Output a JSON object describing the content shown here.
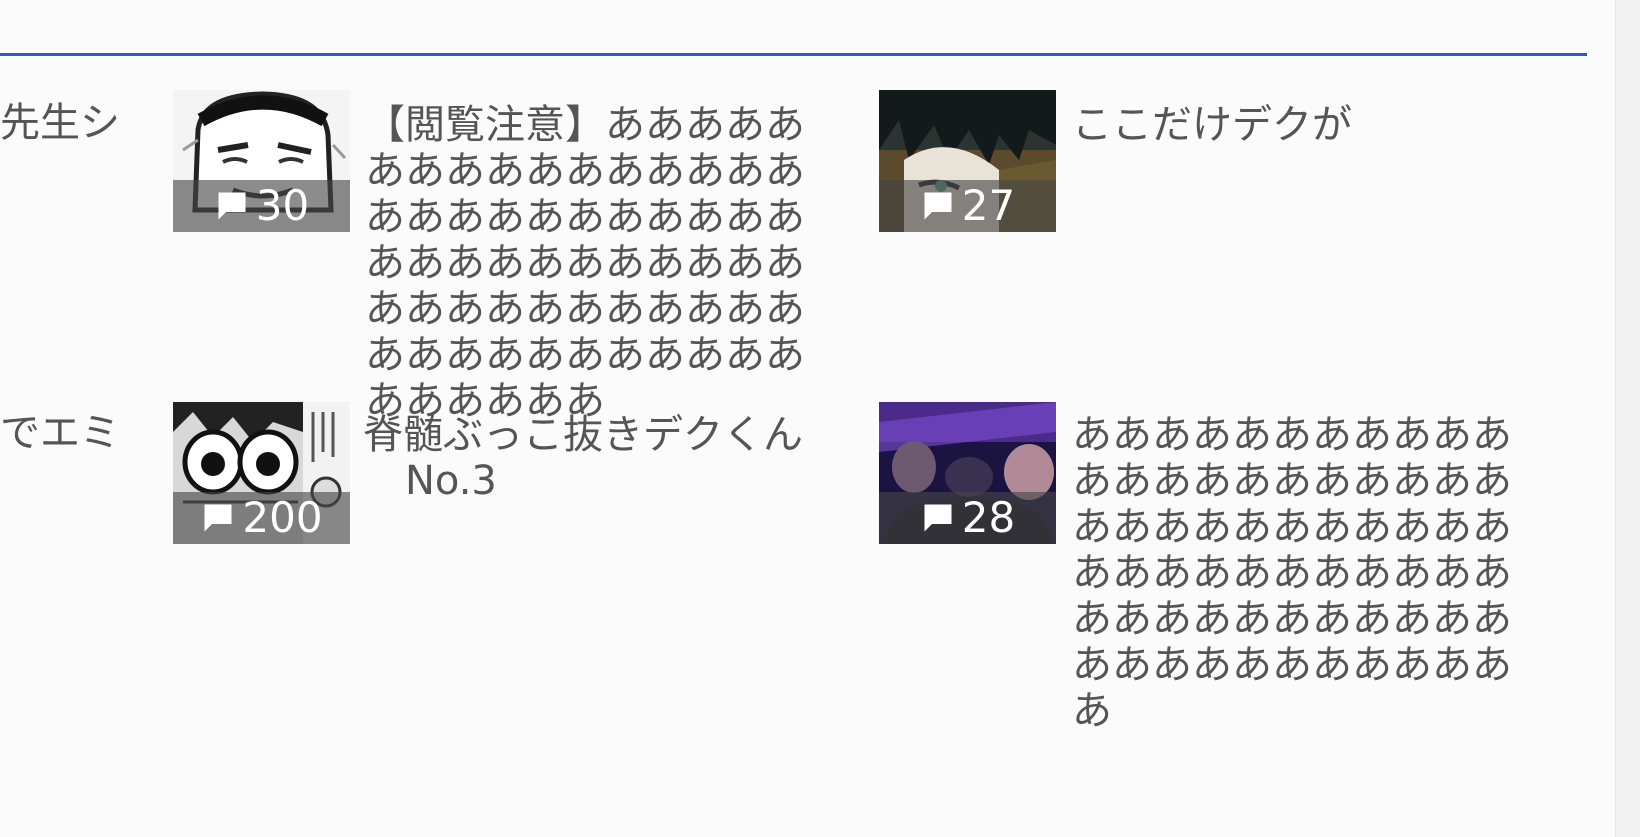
{
  "left_fragments": [
    "先生シ",
    "でエミ"
  ],
  "posts": [
    {
      "title": "【閲覧注意】ああああああああああああああああああああああああああああああああああああああああああああああああああああああああああああああああああ",
      "comment_count": "30",
      "thumb_icon": "manga-face-thumbnail"
    },
    {
      "title": "ここだけデクが",
      "comment_count": "27",
      "thumb_icon": "anime-character-thumbnail"
    },
    {
      "title_line1": "脊髄ぶっこ抜きデクくん",
      "title_line2": "No.3",
      "comment_count": "200",
      "thumb_icon": "manga-wide-eyes-thumbnail"
    },
    {
      "title": "あああああああああああああああああああああああああああああああああああああああああああああああああああああああああああああああああああ",
      "comment_count": "28",
      "thumb_icon": "dark-purple-scene-thumbnail"
    }
  ],
  "colors": {
    "accent_rule": "#2a5cc6",
    "background": "#fbfbfb",
    "text": "#555555"
  }
}
